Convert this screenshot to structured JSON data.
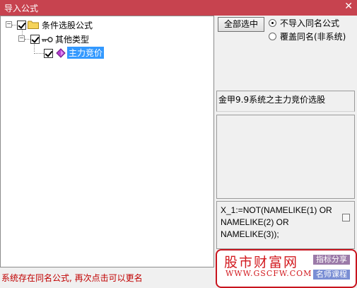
{
  "window": {
    "title": "导入公式",
    "close_glyph": "✕"
  },
  "tree": {
    "root": {
      "label": "条件选股公式",
      "icon": "folder-icon",
      "checked": true
    },
    "child": {
      "label": "其他类型",
      "icon": "key-icon",
      "checked": true
    },
    "leaf": {
      "label": "主力竞价",
      "icon": "gem-icon",
      "checked": true,
      "selected": true
    }
  },
  "options": {
    "select_all_label": "全部选中",
    "radio_no_import": "不导入同名公式",
    "radio_overwrite": "覆盖同名(非系统)",
    "selected": "radio_no_import"
  },
  "info_text": "金甲9.9系统之主力竞价选股",
  "code_text": "X_1:=NOT(NAMELIKE(1) OR NAMELIKE(2) OR NAMELIKE(3));",
  "status_text": "系统存在同名公式, 再次点击可以更名",
  "watermark": {
    "title": "股市财富网",
    "url": "WWW.GSCFW.COM",
    "tag1": "指标分享",
    "tag2": "名师课程"
  }
}
